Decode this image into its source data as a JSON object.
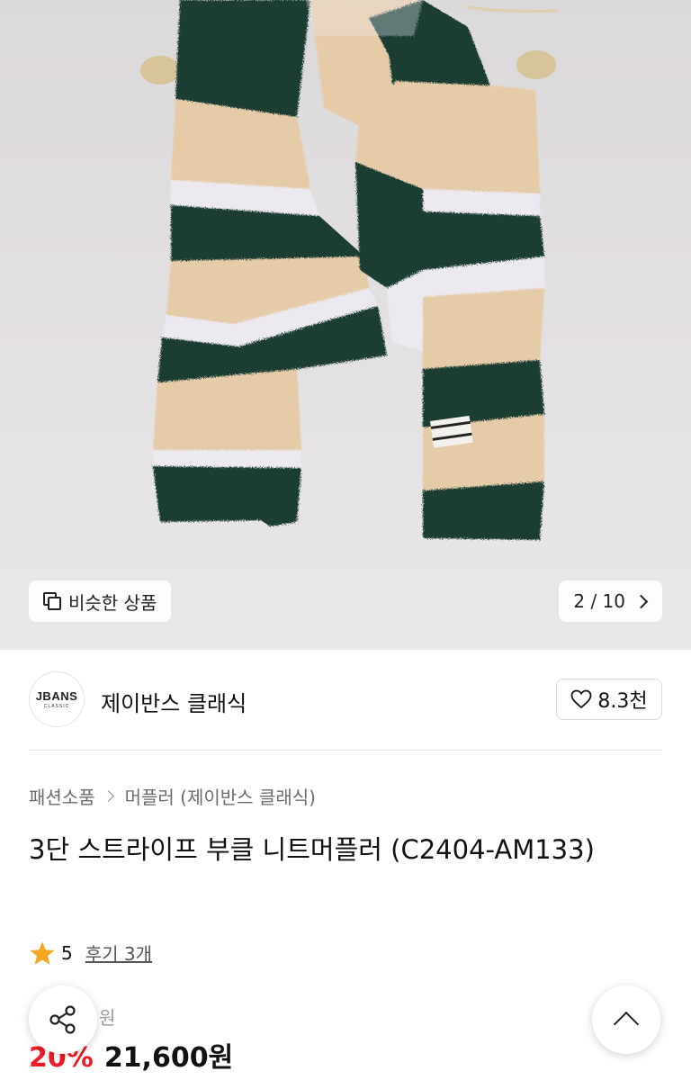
{
  "hero": {
    "similar_label": "비슷한 상품",
    "page_indicator": "2 / 10",
    "image_alt": "striped knit muffler",
    "colors": {
      "green": "#1c3d33",
      "beige": "#e6cba8",
      "white": "#eceaf0"
    }
  },
  "brand": {
    "logo_text": "JBANS",
    "logo_subtext": "CLASSIC",
    "name": "제이반스 클래식",
    "likes": "8.3천"
  },
  "breadcrumb": {
    "category": "패션소품",
    "subcategory": "머플러 (제이반스 클래식)"
  },
  "product": {
    "title": "3단 스트라이프 부클 니트머플러 (C2404-AM133)",
    "rating": "5",
    "reviews": "후기 3개",
    "original_price_suffix": "원",
    "discount": "20%",
    "price": "21,600원"
  },
  "icons": {
    "similar": "similar-items-icon",
    "chevron": "chevron-right-icon",
    "heart": "heart-icon",
    "star": "star-icon",
    "share": "share-icon",
    "scroll_top": "chevron-up-icon"
  },
  "accent": {
    "sale": "#ee1c25",
    "star": "#f5a623"
  }
}
